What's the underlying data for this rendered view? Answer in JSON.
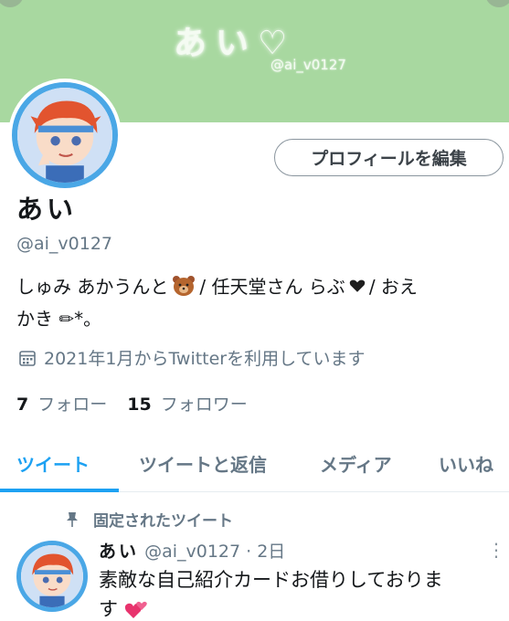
{
  "banner": {
    "title": "あい♡",
    "handle": "@ai_v0127"
  },
  "profile": {
    "edit_button": "プロフィールを編集",
    "name": "あい",
    "handle": "@ai_v0127",
    "bio_part1": "しゅみ あかうんと",
    "bio_part2": " / 任天堂さん らぶ",
    "bio_part3": "/ おえ",
    "bio_line2": "かき ✏︎*。",
    "joined": "2021年1月からTwitterを利用しています",
    "following_count": "7",
    "following_label": "フォロー",
    "followers_count": "15",
    "followers_label": "フォロワー"
  },
  "tabs": [
    {
      "label": "ツイート",
      "active": true
    },
    {
      "label": "ツイートと返信",
      "active": false
    },
    {
      "label": "メディア",
      "active": false
    },
    {
      "label": "いいね",
      "active": false
    }
  ],
  "pinned": {
    "label": "固定されたツイート"
  },
  "tweet": {
    "name": "あい",
    "meta": "@ai_v0127 · 2日",
    "text": "素敵な自己紹介カードお借りしておりま",
    "text_line2": "す"
  },
  "colors": {
    "accent": "#1da1f2",
    "banner": "#a8d8a0",
    "avatar_ring": "#4aa7e6",
    "secondary_text": "#657786"
  },
  "icons": {
    "calendar": "calendar-icon",
    "pin": "pin-icon",
    "more": "more-vertical-icon",
    "bear": "bear-face-icon",
    "heart": "heart-icon"
  }
}
